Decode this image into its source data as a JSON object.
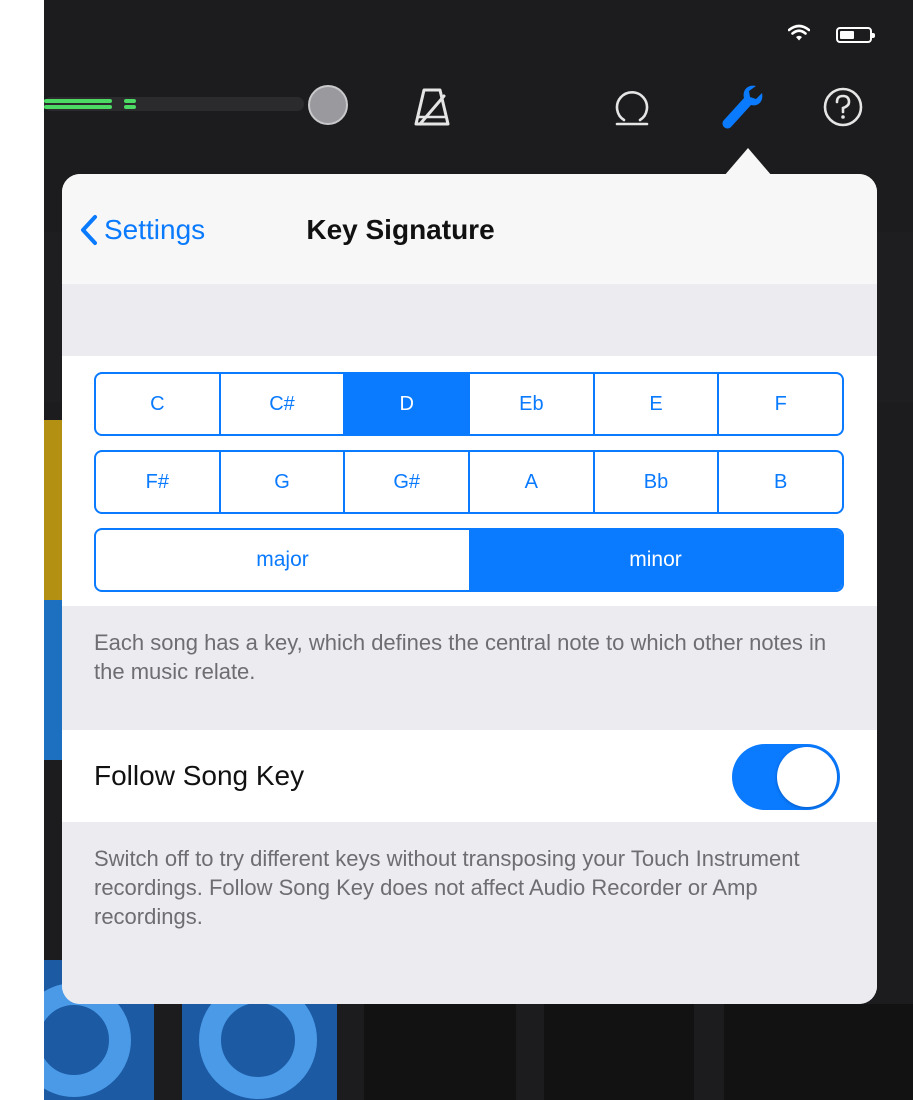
{
  "colors": {
    "accent": "#0a7aff",
    "meter": "#4cd964"
  },
  "toolbar": {
    "icons": [
      "metronome-icon",
      "loop-icon",
      "wrench-icon",
      "help-icon"
    ]
  },
  "popover": {
    "back_label": "Settings",
    "title": "Key Signature",
    "keys_row1": [
      "C",
      "C#",
      "D",
      "Eb",
      "E",
      "F"
    ],
    "keys_row2": [
      "F#",
      "G",
      "G#",
      "A",
      "Bb",
      "B"
    ],
    "selected_key": "D",
    "modes": [
      "major",
      "minor"
    ],
    "selected_mode": "minor",
    "key_description": "Each song has a key, which defines the central note to which other notes in the music relate.",
    "follow_song_key_label": "Follow Song Key",
    "follow_song_key_on": true,
    "follow_description": "Switch off to try different keys without transposing your Touch Instrument recordings. Follow Song Key does not affect Audio Recorder or Amp recordings."
  }
}
